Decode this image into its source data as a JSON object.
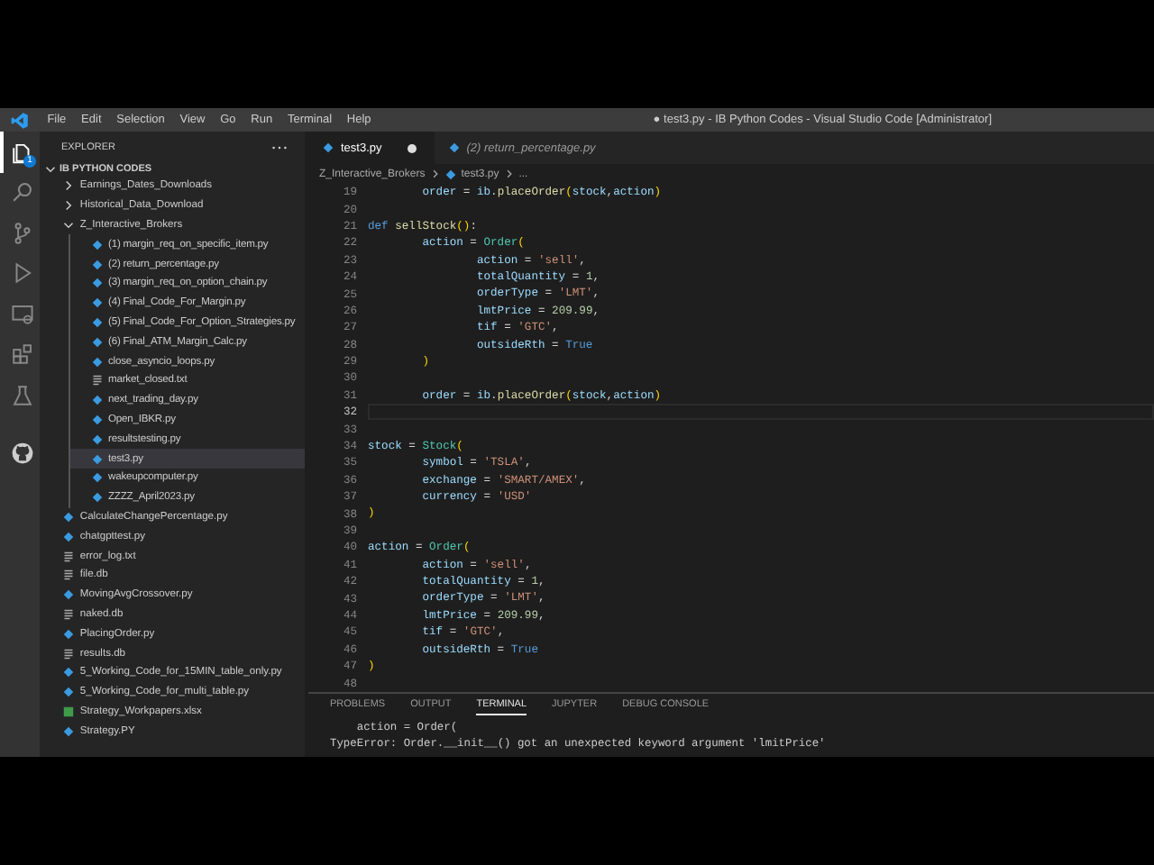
{
  "title_bar": {
    "menu": [
      "File",
      "Edit",
      "Selection",
      "View",
      "Go",
      "Run",
      "Terminal",
      "Help"
    ],
    "title": "● test3.py - IB Python Codes - Visual Studio Code [Administrator]"
  },
  "activity_bar": [
    {
      "kind": "explorer",
      "selected": true,
      "badge": "1"
    },
    {
      "kind": "search",
      "selected": false
    },
    {
      "kind": "source_control",
      "selected": false
    },
    {
      "kind": "run_debug",
      "selected": false
    },
    {
      "kind": "remote",
      "selected": false
    },
    {
      "kind": "extensions",
      "selected": false
    },
    {
      "kind": "testing",
      "selected": false
    },
    {
      "kind": "github",
      "selected": false
    }
  ],
  "sidebar": {
    "title": "EXPLORER",
    "root": {
      "label": "IB PYTHON CODES",
      "expanded": true,
      "children": [
        {
          "kind": "folder",
          "label": "Earnings_Dates_Downloads",
          "expanded": false,
          "selected": false
        },
        {
          "kind": "folder",
          "label": "Historical_Data_Download",
          "expanded": false,
          "selected": false
        },
        {
          "kind": "folder",
          "label": "Z_Interactive_Brokers",
          "expanded": true,
          "selected": false,
          "children": [
            {
              "kind": "py",
              "label": "(1) margin_req_on_specific_item.py",
              "selected": false
            },
            {
              "kind": "py",
              "label": "(2) return_percentage.py",
              "selected": false
            },
            {
              "kind": "py",
              "label": "(3) margin_req_on_option_chain.py",
              "selected": false
            },
            {
              "kind": "py",
              "label": "(4) Final_Code_For_Margin.py",
              "selected": false
            },
            {
              "kind": "py",
              "label": "(5) Final_Code_For_Option_Strategies.py",
              "selected": false
            },
            {
              "kind": "py",
              "label": "(6) Final_ATM_Margin_Calc.py",
              "selected": false
            },
            {
              "kind": "py",
              "label": "close_asyncio_loops.py",
              "selected": false
            },
            {
              "kind": "txt",
              "label": "market_closed.txt",
              "selected": false
            },
            {
              "kind": "py",
              "label": "next_trading_day.py",
              "selected": false
            },
            {
              "kind": "py",
              "label": "Open_IBKR.py",
              "selected": false
            },
            {
              "kind": "py",
              "label": "resultstesting.py",
              "selected": false
            },
            {
              "kind": "py",
              "label": "test3.py",
              "selected": true
            },
            {
              "kind": "py",
              "label": "wakeupcomputer.py",
              "selected": false
            },
            {
              "kind": "py",
              "label": "ZZZZ_April2023.py",
              "selected": false
            }
          ]
        },
        {
          "kind": "py",
          "label": "CalculateChangePercentage.py",
          "selected": false
        },
        {
          "kind": "py",
          "label": "chatgpttest.py",
          "selected": false
        },
        {
          "kind": "txt",
          "label": "error_log.txt",
          "selected": false
        },
        {
          "kind": "txt",
          "label": "file.db",
          "selected": false
        },
        {
          "kind": "py",
          "label": "MovingAvgCrossover.py",
          "selected": false
        },
        {
          "kind": "txt",
          "label": "naked.db",
          "selected": false
        },
        {
          "kind": "py",
          "label": "PlacingOrder.py",
          "selected": false
        },
        {
          "kind": "txt",
          "label": "results.db",
          "selected": false
        },
        {
          "kind": "py",
          "label": "5_Working_Code_for_15MIN_table_only.py",
          "selected": false
        },
        {
          "kind": "py",
          "label": "5_Working_Code_for_multi_table.py",
          "selected": false
        },
        {
          "kind": "xlsx",
          "label": "Strategy_Workpapers.xlsx",
          "selected": false
        },
        {
          "kind": "py",
          "label": "Strategy.PY",
          "selected": false
        }
      ]
    }
  },
  "editor": {
    "tabs": [
      {
        "label": "test3.py",
        "selected": true,
        "modified": true,
        "preview": false
      },
      {
        "label": "(2) return_percentage.py",
        "selected": false,
        "modified": false,
        "preview": true
      }
    ],
    "breadcrumb": [
      "Z_Interactive_Brokers",
      "test3.py",
      "..."
    ],
    "lines": [
      {
        "number": "19",
        "current": false,
        "tokens": [
          {
            "kind": "var",
            "text": "        order"
          },
          {
            "kind": "op",
            "text": " = "
          },
          {
            "kind": "var",
            "text": "ib"
          },
          {
            "kind": "op",
            "text": "."
          },
          {
            "kind": "fn",
            "text": "placeOrder"
          },
          {
            "kind": "paren",
            "text": "("
          },
          {
            "kind": "var",
            "text": "stock"
          },
          {
            "kind": "op",
            "text": ","
          },
          {
            "kind": "var",
            "text": "action"
          },
          {
            "kind": "paren",
            "text": ")"
          }
        ]
      },
      {
        "number": "20",
        "current": false
      },
      {
        "number": "21",
        "current": false,
        "tokens": [
          {
            "kind": "kw",
            "text": "def "
          },
          {
            "kind": "fn",
            "text": "sellStock"
          },
          {
            "kind": "paren",
            "text": "()"
          },
          {
            "kind": "op",
            "text": ":"
          }
        ]
      },
      {
        "number": "22",
        "current": false,
        "tokens": [
          {
            "kind": "var",
            "text": "        action"
          },
          {
            "kind": "op",
            "text": " = "
          },
          {
            "kind": "cls",
            "text": "Order"
          },
          {
            "kind": "paren",
            "text": "("
          }
        ]
      },
      {
        "number": "23",
        "current": false,
        "tokens": [
          {
            "kind": "var",
            "text": "                action"
          },
          {
            "kind": "op",
            "text": " = "
          },
          {
            "kind": "str",
            "text": "'sell'"
          },
          {
            "kind": "op",
            "text": ","
          }
        ]
      },
      {
        "number": "24",
        "current": false,
        "tokens": [
          {
            "kind": "var",
            "text": "                totalQuantity"
          },
          {
            "kind": "op",
            "text": " = "
          },
          {
            "kind": "num",
            "text": "1"
          },
          {
            "kind": "op",
            "text": ","
          }
        ]
      },
      {
        "number": "25",
        "current": false,
        "tokens": [
          {
            "kind": "var",
            "text": "                orderType"
          },
          {
            "kind": "op",
            "text": " = "
          },
          {
            "kind": "str",
            "text": "'LMT'"
          },
          {
            "kind": "op",
            "text": ","
          }
        ]
      },
      {
        "number": "26",
        "current": false,
        "tokens": [
          {
            "kind": "var",
            "text": "                lmtPrice"
          },
          {
            "kind": "op",
            "text": " = "
          },
          {
            "kind": "num",
            "text": "209.99"
          },
          {
            "kind": "op",
            "text": ","
          }
        ]
      },
      {
        "number": "27",
        "current": false,
        "tokens": [
          {
            "kind": "var",
            "text": "                tif"
          },
          {
            "kind": "op",
            "text": " = "
          },
          {
            "kind": "str",
            "text": "'GTC'"
          },
          {
            "kind": "op",
            "text": ","
          }
        ]
      },
      {
        "number": "28",
        "current": false,
        "tokens": [
          {
            "kind": "var",
            "text": "                outsideRth"
          },
          {
            "kind": "op",
            "text": " = "
          },
          {
            "kind": "kw",
            "text": "True"
          }
        ]
      },
      {
        "number": "29",
        "current": false,
        "tokens": [
          {
            "kind": "paren",
            "text": "        )"
          }
        ]
      },
      {
        "number": "30",
        "current": false
      },
      {
        "number": "31",
        "current": false,
        "tokens": [
          {
            "kind": "var",
            "text": "        order"
          },
          {
            "kind": "op",
            "text": " = "
          },
          {
            "kind": "var",
            "text": "ib"
          },
          {
            "kind": "op",
            "text": "."
          },
          {
            "kind": "fn",
            "text": "placeOrder"
          },
          {
            "kind": "paren",
            "text": "("
          },
          {
            "kind": "var",
            "text": "stock"
          },
          {
            "kind": "op",
            "text": ","
          },
          {
            "kind": "var",
            "text": "action"
          },
          {
            "kind": "paren",
            "text": ")"
          }
        ]
      },
      {
        "number": "32",
        "current": true
      },
      {
        "number": "33",
        "current": false
      },
      {
        "number": "34",
        "current": false,
        "tokens": [
          {
            "kind": "var",
            "text": "stock"
          },
          {
            "kind": "op",
            "text": " = "
          },
          {
            "kind": "cls",
            "text": "Stock"
          },
          {
            "kind": "paren",
            "text": "("
          }
        ]
      },
      {
        "number": "35",
        "current": false,
        "tokens": [
          {
            "kind": "var",
            "text": "        symbol"
          },
          {
            "kind": "op",
            "text": " = "
          },
          {
            "kind": "str",
            "text": "'TSLA'"
          },
          {
            "kind": "op",
            "text": ","
          }
        ]
      },
      {
        "number": "36",
        "current": false,
        "tokens": [
          {
            "kind": "var",
            "text": "        exchange"
          },
          {
            "kind": "op",
            "text": " = "
          },
          {
            "kind": "str",
            "text": "'SMART/AMEX'"
          },
          {
            "kind": "op",
            "text": ","
          }
        ]
      },
      {
        "number": "37",
        "current": false,
        "tokens": [
          {
            "kind": "var",
            "text": "        currency"
          },
          {
            "kind": "op",
            "text": " = "
          },
          {
            "kind": "str",
            "text": "'USD'"
          }
        ]
      },
      {
        "number": "38",
        "current": false,
        "tokens": [
          {
            "kind": "paren",
            "text": ")"
          }
        ]
      },
      {
        "number": "39",
        "current": false
      },
      {
        "number": "40",
        "current": false,
        "tokens": [
          {
            "kind": "var",
            "text": "action"
          },
          {
            "kind": "op",
            "text": " = "
          },
          {
            "kind": "cls",
            "text": "Order"
          },
          {
            "kind": "paren",
            "text": "("
          }
        ]
      },
      {
        "number": "41",
        "current": false,
        "tokens": [
          {
            "kind": "var",
            "text": "        action"
          },
          {
            "kind": "op",
            "text": " = "
          },
          {
            "kind": "str",
            "text": "'sell'"
          },
          {
            "kind": "op",
            "text": ","
          }
        ]
      },
      {
        "number": "42",
        "current": false,
        "tokens": [
          {
            "kind": "var",
            "text": "        totalQuantity"
          },
          {
            "kind": "op",
            "text": " = "
          },
          {
            "kind": "num",
            "text": "1"
          },
          {
            "kind": "op",
            "text": ","
          }
        ]
      },
      {
        "number": "43",
        "current": false,
        "tokens": [
          {
            "kind": "var",
            "text": "        orderType"
          },
          {
            "kind": "op",
            "text": " = "
          },
          {
            "kind": "str",
            "text": "'LMT'"
          },
          {
            "kind": "op",
            "text": ","
          }
        ]
      },
      {
        "number": "44",
        "current": false,
        "tokens": [
          {
            "kind": "var",
            "text": "        lmtPrice"
          },
          {
            "kind": "op",
            "text": " = "
          },
          {
            "kind": "num",
            "text": "209.99"
          },
          {
            "kind": "op",
            "text": ","
          }
        ]
      },
      {
        "number": "45",
        "current": false,
        "tokens": [
          {
            "kind": "var",
            "text": "        tif"
          },
          {
            "kind": "op",
            "text": " = "
          },
          {
            "kind": "str",
            "text": "'GTC'"
          },
          {
            "kind": "op",
            "text": ","
          }
        ]
      },
      {
        "number": "46",
        "current": false,
        "tokens": [
          {
            "kind": "var",
            "text": "        outsideRth"
          },
          {
            "kind": "op",
            "text": " = "
          },
          {
            "kind": "kw",
            "text": "True"
          }
        ]
      },
      {
        "number": "47",
        "current": false,
        "tokens": [
          {
            "kind": "paren",
            "text": ")"
          }
        ]
      },
      {
        "number": "48",
        "current": false
      }
    ]
  },
  "panel": {
    "tabs": [
      {
        "label": "PROBLEMS",
        "selected": false
      },
      {
        "label": "OUTPUT",
        "selected": false
      },
      {
        "label": "TERMINAL",
        "selected": true
      },
      {
        "label": "JUPYTER",
        "selected": false
      },
      {
        "label": "DEBUG CONSOLE",
        "selected": false
      }
    ],
    "terminal": [
      "    action = Order(",
      "TypeError: Order.__init__() got an unexpected keyword argument 'lmitPrice'"
    ]
  }
}
